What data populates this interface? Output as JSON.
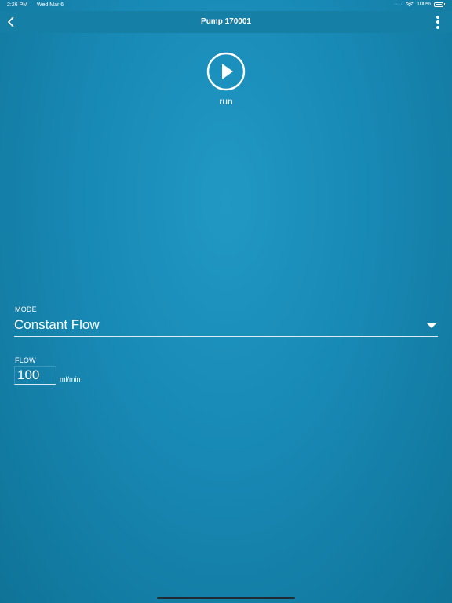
{
  "status_bar": {
    "time": "2:26 PM",
    "date": "Wed Mar 6",
    "battery_percent": "100%",
    "wifi_icon": "wifi-icon",
    "battery_icon": "battery-icon"
  },
  "nav": {
    "title": "Pump 170001",
    "back_icon": "chevron-left-icon",
    "more_icon": "more-vertical-icon"
  },
  "run": {
    "label": "run",
    "icon": "play-icon"
  },
  "mode": {
    "label": "MODE",
    "value": "Constant Flow",
    "dropdown_icon": "caret-down-icon"
  },
  "flow": {
    "label": "FLOW",
    "value": "100",
    "unit": "ml/min"
  },
  "colors": {
    "background": "#1a8cb8",
    "nav_bar": "#157fa6",
    "foreground": "#ffffff"
  }
}
